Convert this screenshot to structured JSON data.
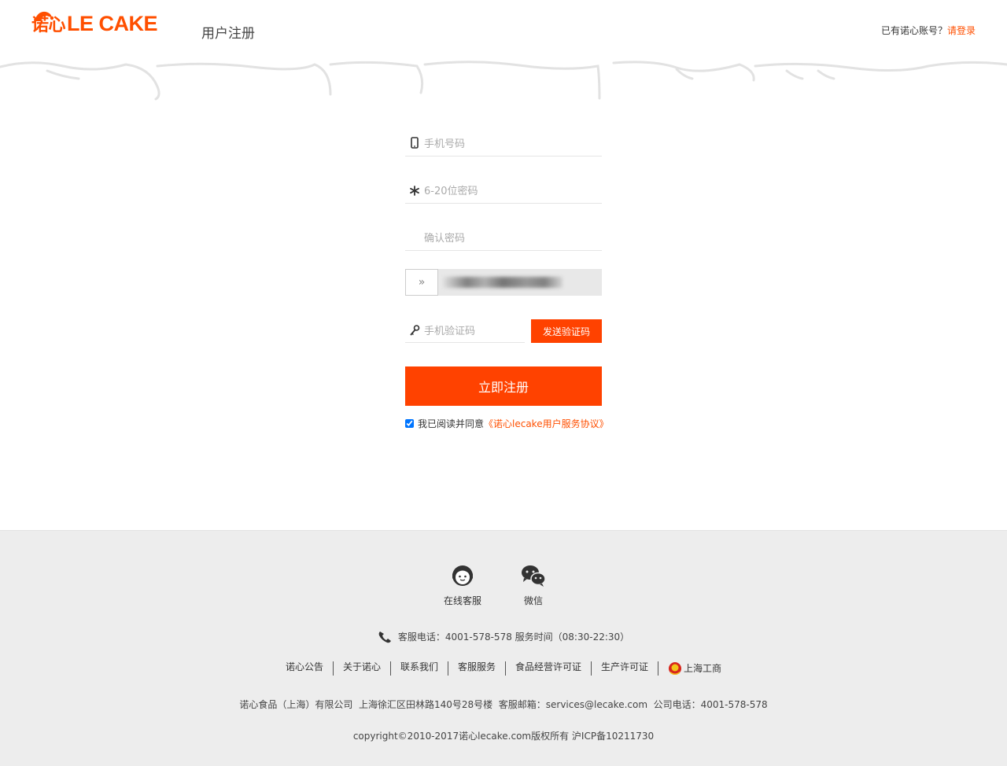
{
  "header": {
    "logo_cn": "诺心",
    "logo_en": "LE CAKE",
    "page_title": "用户注册",
    "login_prompt": "已有诺心账号？",
    "login_link": "请登录"
  },
  "form": {
    "phone_placeholder": "手机号码",
    "password_placeholder": "6-20位密码",
    "confirm_placeholder": "确认密码",
    "slider_handle": "»",
    "sms_placeholder": "手机验证码",
    "sms_button": "发送验证码",
    "submit_label": "立即注册",
    "agree_text": "我已阅读并同意",
    "agree_link": "《诺心lecake用户服务协议》",
    "agree_checked": true
  },
  "footer": {
    "icons": [
      {
        "label": "在线客服",
        "icon": "customer-service-icon"
      },
      {
        "label": "微信",
        "icon": "wechat-icon"
      }
    ],
    "phone_line": "客服电话：4001-578-578 服务时间（08:30-22:30）",
    "links": [
      "诺心公告",
      "关于诺心",
      "联系我们",
      "客服服务",
      "食品经营许可证",
      "生产许可证",
      "上海工商"
    ],
    "address": "诺心食品（上海）有限公司  上海徐汇区田林路140号28号楼  客服邮箱：services@lecake.com  公司电话：4001-578-578",
    "copyright": "copyright©2010-2017诺心lecake.com版权所有 沪ICP备10211730"
  },
  "colors": {
    "brand": "#ff4f00",
    "button": "#ff4200",
    "footer_bg": "#ededed"
  }
}
